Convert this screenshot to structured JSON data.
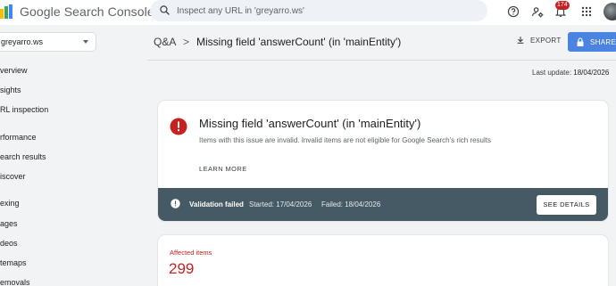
{
  "header": {
    "product_name": "Google Search Console",
    "search_placeholder": "Inspect any URL in 'greyarro.ws'",
    "notification_count": "174"
  },
  "sidebar": {
    "property": "greyarro.ws",
    "items": [
      {
        "label": "Overview"
      },
      {
        "label": "Insights"
      },
      {
        "label": "URL inspection"
      },
      {
        "label": "Performance"
      },
      {
        "label": "Search results"
      },
      {
        "label": "Discover"
      },
      {
        "label": "Indexing"
      },
      {
        "label": "Pages"
      },
      {
        "label": "Videos"
      },
      {
        "label": "Sitemaps"
      },
      {
        "label": "Removals"
      }
    ],
    "visible_items": [
      {
        "label": "verview"
      },
      {
        "label": "sights"
      },
      {
        "label": "RL inspection"
      },
      {
        "label": "rformance"
      },
      {
        "label": "earch results"
      },
      {
        "label": "iscover"
      },
      {
        "label": "exing"
      },
      {
        "label": "ages"
      },
      {
        "label": "deos"
      },
      {
        "label": "temaps"
      },
      {
        "label": "emovals"
      }
    ]
  },
  "main": {
    "breadcrumb": "Q&A",
    "breadcrumb_sep": ">",
    "title": "Missing field 'answerCount' (in 'mainEntity')",
    "export_label": "EXPORT",
    "share_label": "SHARE",
    "last_update_label": "Last update:",
    "last_update_value": "18/04/2026",
    "issue": {
      "title": "Missing field 'answerCount' (in 'mainEntity')",
      "description": "Items with this issue are invalid. Invalid items are not eligible for Google Search's rich results",
      "learn_more": "LEARN MORE",
      "validation_status": "Validation failed",
      "started": "Started: 17/04/2026",
      "failed": "Failed: 18/04/2026",
      "see_details": "SEE DETAILS"
    },
    "affected": {
      "label": "Affected items",
      "value": "299"
    }
  },
  "colors": {
    "error": "#c5221f",
    "share_button": "#4a84e0",
    "status_bar": "#455a64"
  }
}
